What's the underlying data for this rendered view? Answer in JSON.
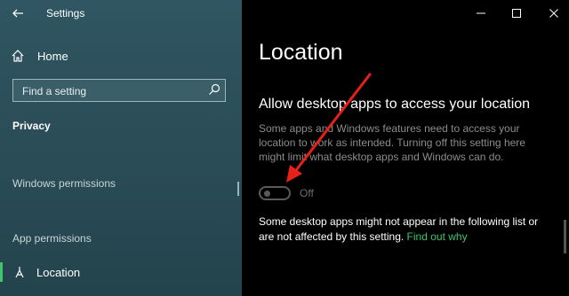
{
  "window": {
    "title": "Settings"
  },
  "sidebar": {
    "home_label": "Home",
    "search_placeholder": "Find a setting",
    "section_title": "Privacy",
    "group_windows": "Windows permissions",
    "group_app": "App permissions",
    "selected_item": "Location"
  },
  "main": {
    "page_title": "Location",
    "setting_title": "Allow desktop apps to access your location",
    "description": "Some apps and Windows features need to access your location to work as intended. Turning off this setting here might limit what desktop apps and Windows can do.",
    "toggle_state": "Off",
    "note_text": "Some desktop apps might not appear in the following list or are not affected by this setting. ",
    "note_link": "Find out why"
  },
  "colors": {
    "accent": "#3fc56b",
    "annotation_arrow": "#e8201a",
    "sidebar_bg": "#2b4f5a"
  },
  "icons": [
    "back-arrow-icon",
    "home-icon",
    "search-icon",
    "location-icon",
    "minimize-icon",
    "maximize-icon",
    "close-icon"
  ]
}
